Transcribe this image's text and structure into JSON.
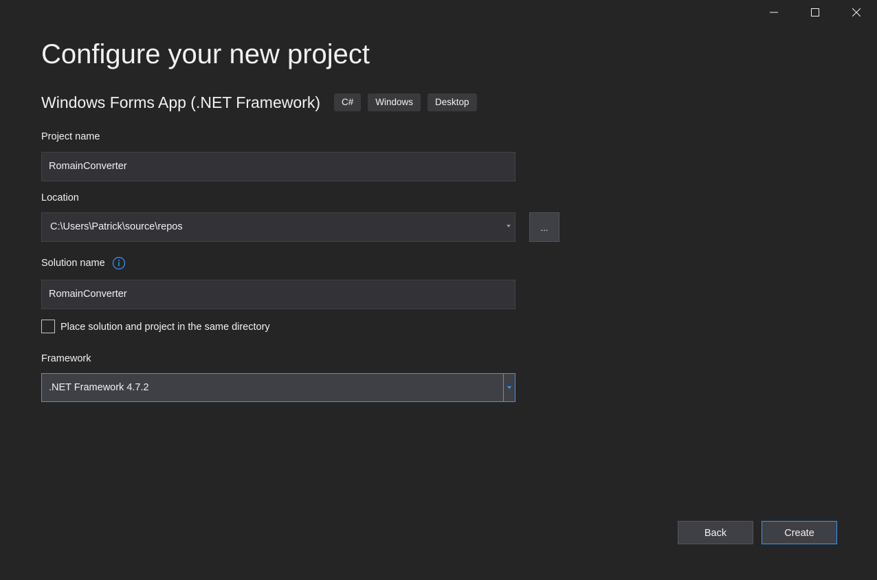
{
  "window": {
    "controls": {
      "minimize_icon": "minimize-icon",
      "maximize_icon": "maximize-icon",
      "close_icon": "close-icon"
    }
  },
  "page": {
    "title": "Configure your new project",
    "template_name": "Windows Forms App (.NET Framework)",
    "tags": [
      "C#",
      "Windows",
      "Desktop"
    ]
  },
  "form": {
    "project_name": {
      "label": "Project name",
      "value": "RomainConverter"
    },
    "location": {
      "label": "Location",
      "value": "C:\\Users\\Patrick\\source\\repos",
      "browse_label": "..."
    },
    "solution_name": {
      "label": "Solution name",
      "value": "RomainConverter",
      "info_icon": "info-icon"
    },
    "same_directory": {
      "label": "Place solution and project in the same directory",
      "checked": false
    },
    "framework": {
      "label": "Framework",
      "value": ".NET Framework 4.7.2"
    }
  },
  "actions": {
    "back_label": "Back",
    "create_label": "Create"
  },
  "colors": {
    "background": "#252526",
    "input_background": "#333337",
    "accent": "#3399ff",
    "text": "#f1f1f1"
  }
}
